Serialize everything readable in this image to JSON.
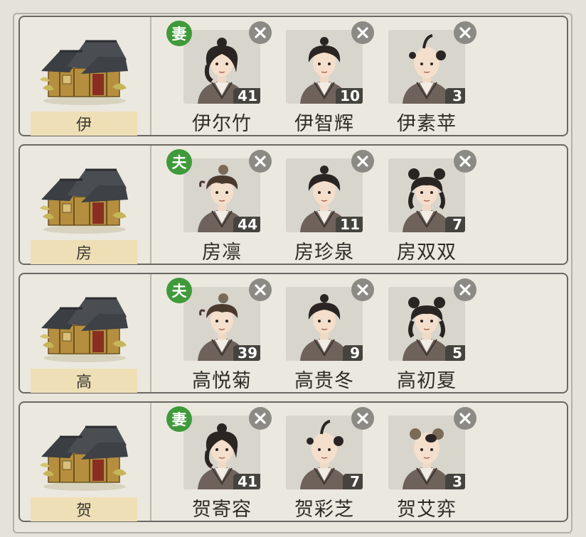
{
  "households": [
    {
      "surname": "伊",
      "members": [
        {
          "name": "伊尔竹",
          "age": "41",
          "badge": "妻",
          "look": "woman-bun"
        },
        {
          "name": "伊智辉",
          "age": "10",
          "badge": "",
          "look": "youth-bun"
        },
        {
          "name": "伊素苹",
          "age": "3",
          "badge": "",
          "look": "toddler-tuft"
        }
      ]
    },
    {
      "surname": "房",
      "members": [
        {
          "name": "房凛",
          "age": "44",
          "badge": "夫",
          "look": "man-topknot"
        },
        {
          "name": "房珍泉",
          "age": "11",
          "badge": "",
          "look": "youth-bun"
        },
        {
          "name": "房双双",
          "age": "7",
          "badge": "",
          "look": "girl-double-buns"
        }
      ]
    },
    {
      "surname": "高",
      "members": [
        {
          "name": "高悦菊",
          "age": "39",
          "badge": "夫",
          "look": "man-topknot"
        },
        {
          "name": "高贵冬",
          "age": "9",
          "badge": "",
          "look": "youth-bun"
        },
        {
          "name": "高初夏",
          "age": "5",
          "badge": "",
          "look": "girl-double-buns"
        }
      ]
    },
    {
      "surname": "贺",
      "members": [
        {
          "name": "贺寄容",
          "age": "41",
          "badge": "妻",
          "look": "woman-bun"
        },
        {
          "name": "贺彩芝",
          "age": "7",
          "badge": "",
          "look": "toddler-tuft"
        },
        {
          "name": "贺艾弈",
          "age": "3",
          "badge": "",
          "look": "toddler-buns"
        }
      ]
    }
  ],
  "icons": {
    "remove": "close-circle-icon",
    "house": "house-icon"
  },
  "colors": {
    "badge": "#3f9a3a",
    "age_tag": "#45433e",
    "surname_box": "#eedfb6",
    "remove_button": "#8c8a85"
  }
}
